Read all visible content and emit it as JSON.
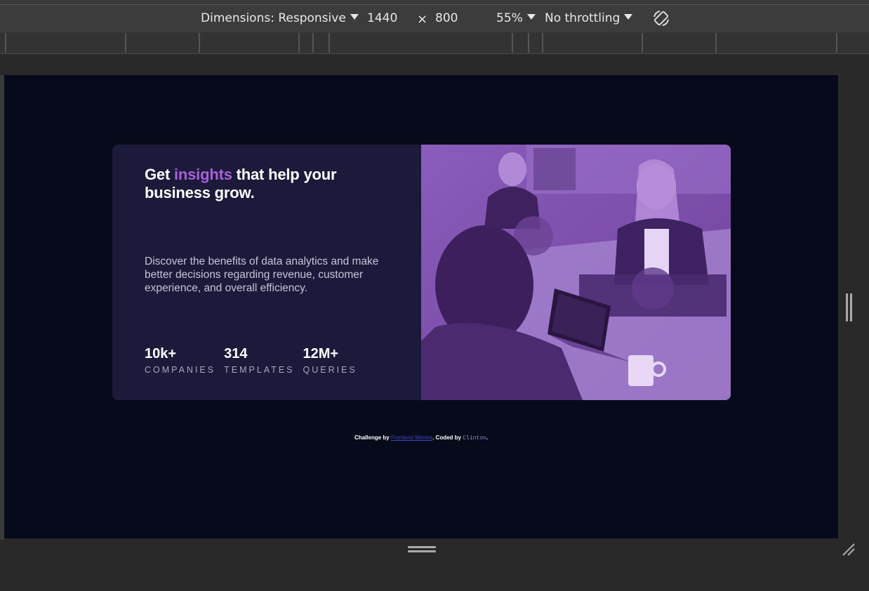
{
  "devtools": {
    "dimensions_label": "Dimensions: Responsive",
    "width_value": "1440",
    "times_symbol": "×",
    "height_value": "800",
    "zoom": "55%",
    "throttling": "No throttling"
  },
  "card": {
    "headline_part1": "Get ",
    "headline_accent": "insights",
    "headline_part2": " that help your business grow.",
    "description": "Discover the benefits of data analytics and make better decisions regarding revenue, customer experience, and overall efficiency.",
    "stats": [
      {
        "value": "10k+",
        "label": "COMPANIES"
      },
      {
        "value": "314",
        "label": "TEMPLATES"
      },
      {
        "value": "12M+",
        "label": "QUERIES"
      }
    ]
  },
  "footer": {
    "prefix": "Challenge by ",
    "link": "Frontend Mentor",
    "middle": ". Coded by ",
    "coder": "Clinton",
    "suffix": "."
  },
  "colors": {
    "page_bg": "#070a1a",
    "card_bg": "#1c1a3a",
    "accent": "#a860d8",
    "image_overlay": "#7a4ea8"
  }
}
